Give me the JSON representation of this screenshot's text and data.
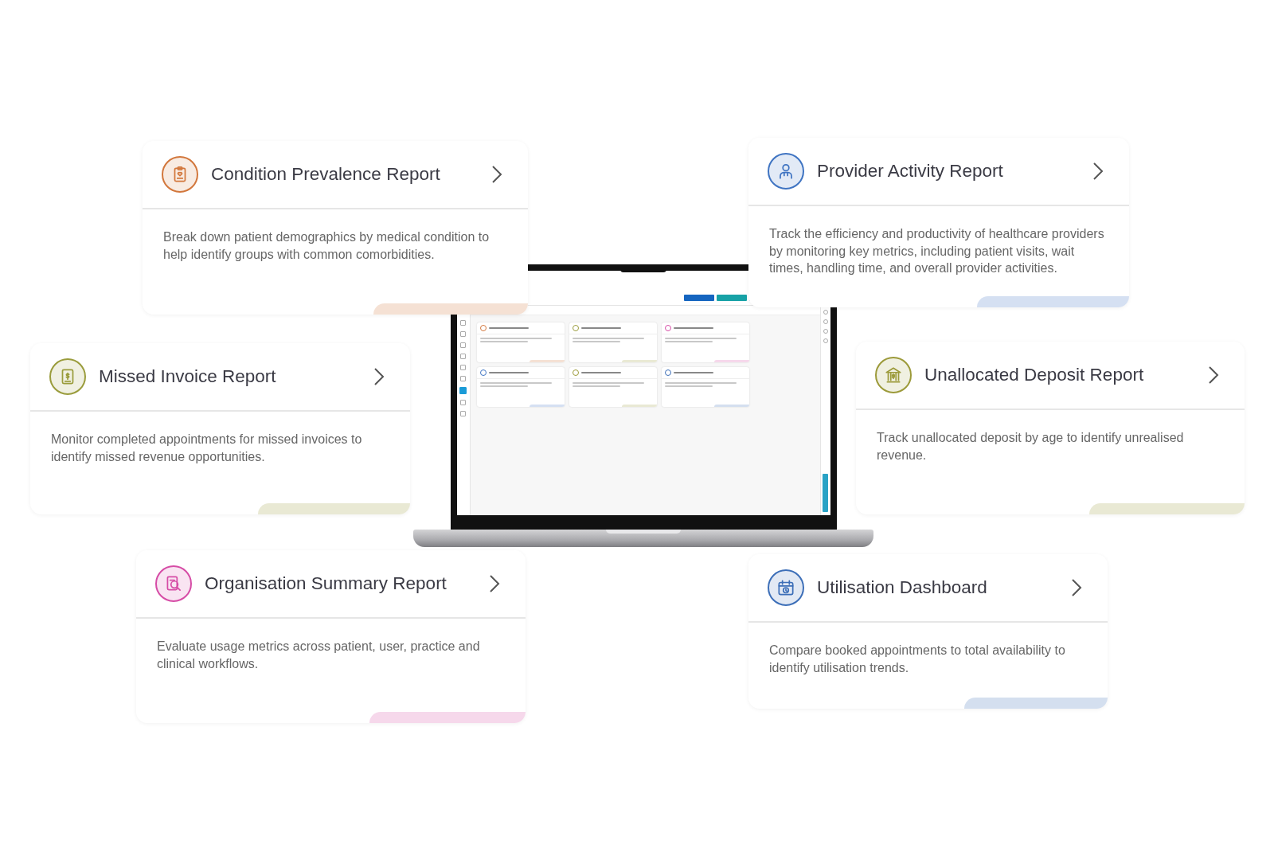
{
  "feature_cards": [
    {
      "title": "Condition Prevalence Report",
      "description": "Break down patient demographics by medical condition to help identify groups with common comorbidities.",
      "color": "#d2773c",
      "kind": "clipboard"
    },
    {
      "title": "Provider Activity Report",
      "description": "Track the efficiency and productivity of healthcare providers by monitoring key metrics, including patient visits, wait times, handling time, and overall provider activities.",
      "color": "#3f74c2",
      "kind": "person"
    },
    {
      "title": "Missed Invoice Report",
      "description": "Monitor completed appointments for missed invoices to identify missed revenue opportunities.",
      "color": "#9a9c3c",
      "kind": "invoice"
    },
    {
      "title": "Unallocated Deposit Report",
      "description": "Track unallocated deposit by age to identify unrealised revenue.",
      "color": "#9c9a3a",
      "kind": "bank"
    },
    {
      "title": "Organisation Summary Report",
      "description": "Evaluate usage metrics across patient, user, practice and clinical workflows.",
      "color": "#d64ca6",
      "kind": "search"
    },
    {
      "title": "Utilisation Dashboard",
      "description": "Compare booked appointments to total availability to identify utilisation trends.",
      "color": "#3d6fb8",
      "kind": "calendar"
    }
  ]
}
